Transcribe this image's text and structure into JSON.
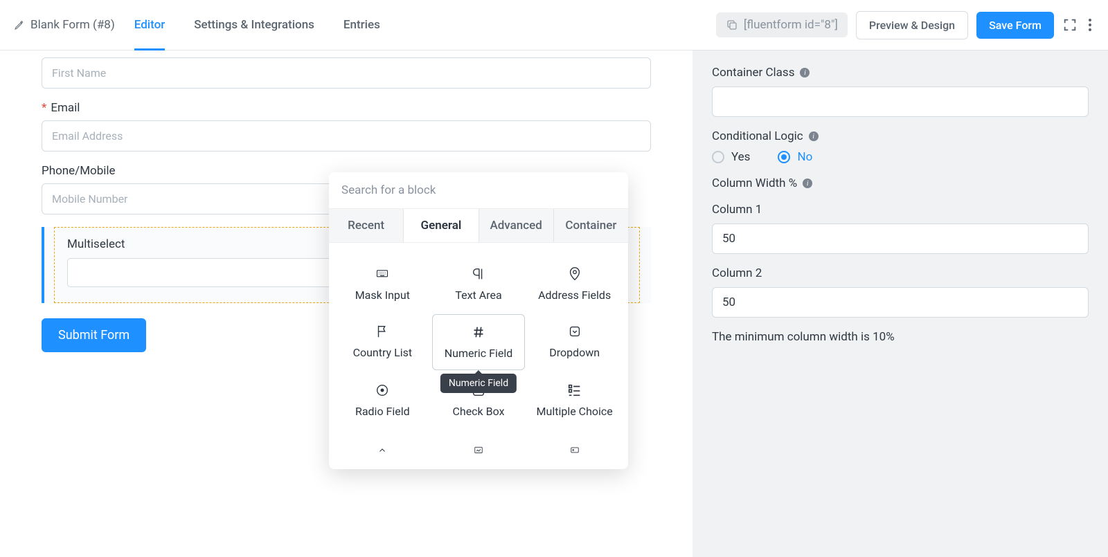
{
  "header": {
    "form_title": "Blank Form (#8)",
    "tabs": {
      "editor": "Editor",
      "settings": "Settings & Integrations",
      "entries": "Entries"
    },
    "shortcode": "[fluentform id=\"8\"]",
    "preview_btn": "Preview & Design",
    "save_btn": "Save Form"
  },
  "canvas": {
    "first_name_placeholder": "First Name",
    "email_label": "Email",
    "email_placeholder": "Email Address",
    "phone_label": "Phone/Mobile",
    "phone_placeholder": "Mobile Number",
    "multiselect_label": "Multiselect",
    "submit_label": "Submit Form"
  },
  "popover": {
    "search_placeholder": "Search for a block",
    "tabs": {
      "recent": "Recent",
      "general": "General",
      "advanced": "Advanced",
      "container": "Container"
    },
    "blocks": {
      "mask": "Mask Input",
      "textarea": "Text Area",
      "address": "Address Fields",
      "country": "Country List",
      "numeric": "Numeric Field",
      "dropdown": "Dropdown",
      "radio": "Radio Field",
      "checkbox": "Check Box",
      "multiple": "Multiple Choice"
    },
    "tooltip": "Numeric Field"
  },
  "sidebar": {
    "container_class_label": "Container Class",
    "container_class_value": "",
    "cond_logic_label": "Conditional Logic",
    "cond_yes": "Yes",
    "cond_no": "No",
    "col_width_label": "Column Width %",
    "col1_label": "Column 1",
    "col1_value": "50",
    "col2_label": "Column 2",
    "col2_value": "50",
    "note": "The minimum column width is 10%"
  }
}
